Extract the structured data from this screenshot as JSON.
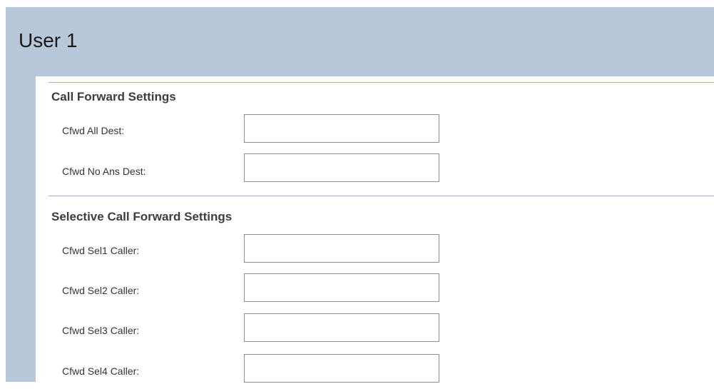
{
  "page": {
    "title": "User 1"
  },
  "call_forward": {
    "title": "Call Forward Settings",
    "fields": [
      {
        "label": "Cfwd All Dest:",
        "value": ""
      },
      {
        "label": "Cfwd No Ans Dest:",
        "value": ""
      }
    ]
  },
  "selective_call_forward": {
    "title": "Selective Call Forward Settings",
    "fields": [
      {
        "label": "Cfwd Sel1 Caller:",
        "value": ""
      },
      {
        "label": "Cfwd Sel2 Caller:",
        "value": ""
      },
      {
        "label": "Cfwd Sel3 Caller:",
        "value": ""
      },
      {
        "label": "Cfwd Sel4 Caller:",
        "value": ""
      }
    ]
  },
  "colors": {
    "header_background": "#b8c7d9",
    "divider": "#a5a9cf",
    "input_border": "#8e8e8e"
  }
}
